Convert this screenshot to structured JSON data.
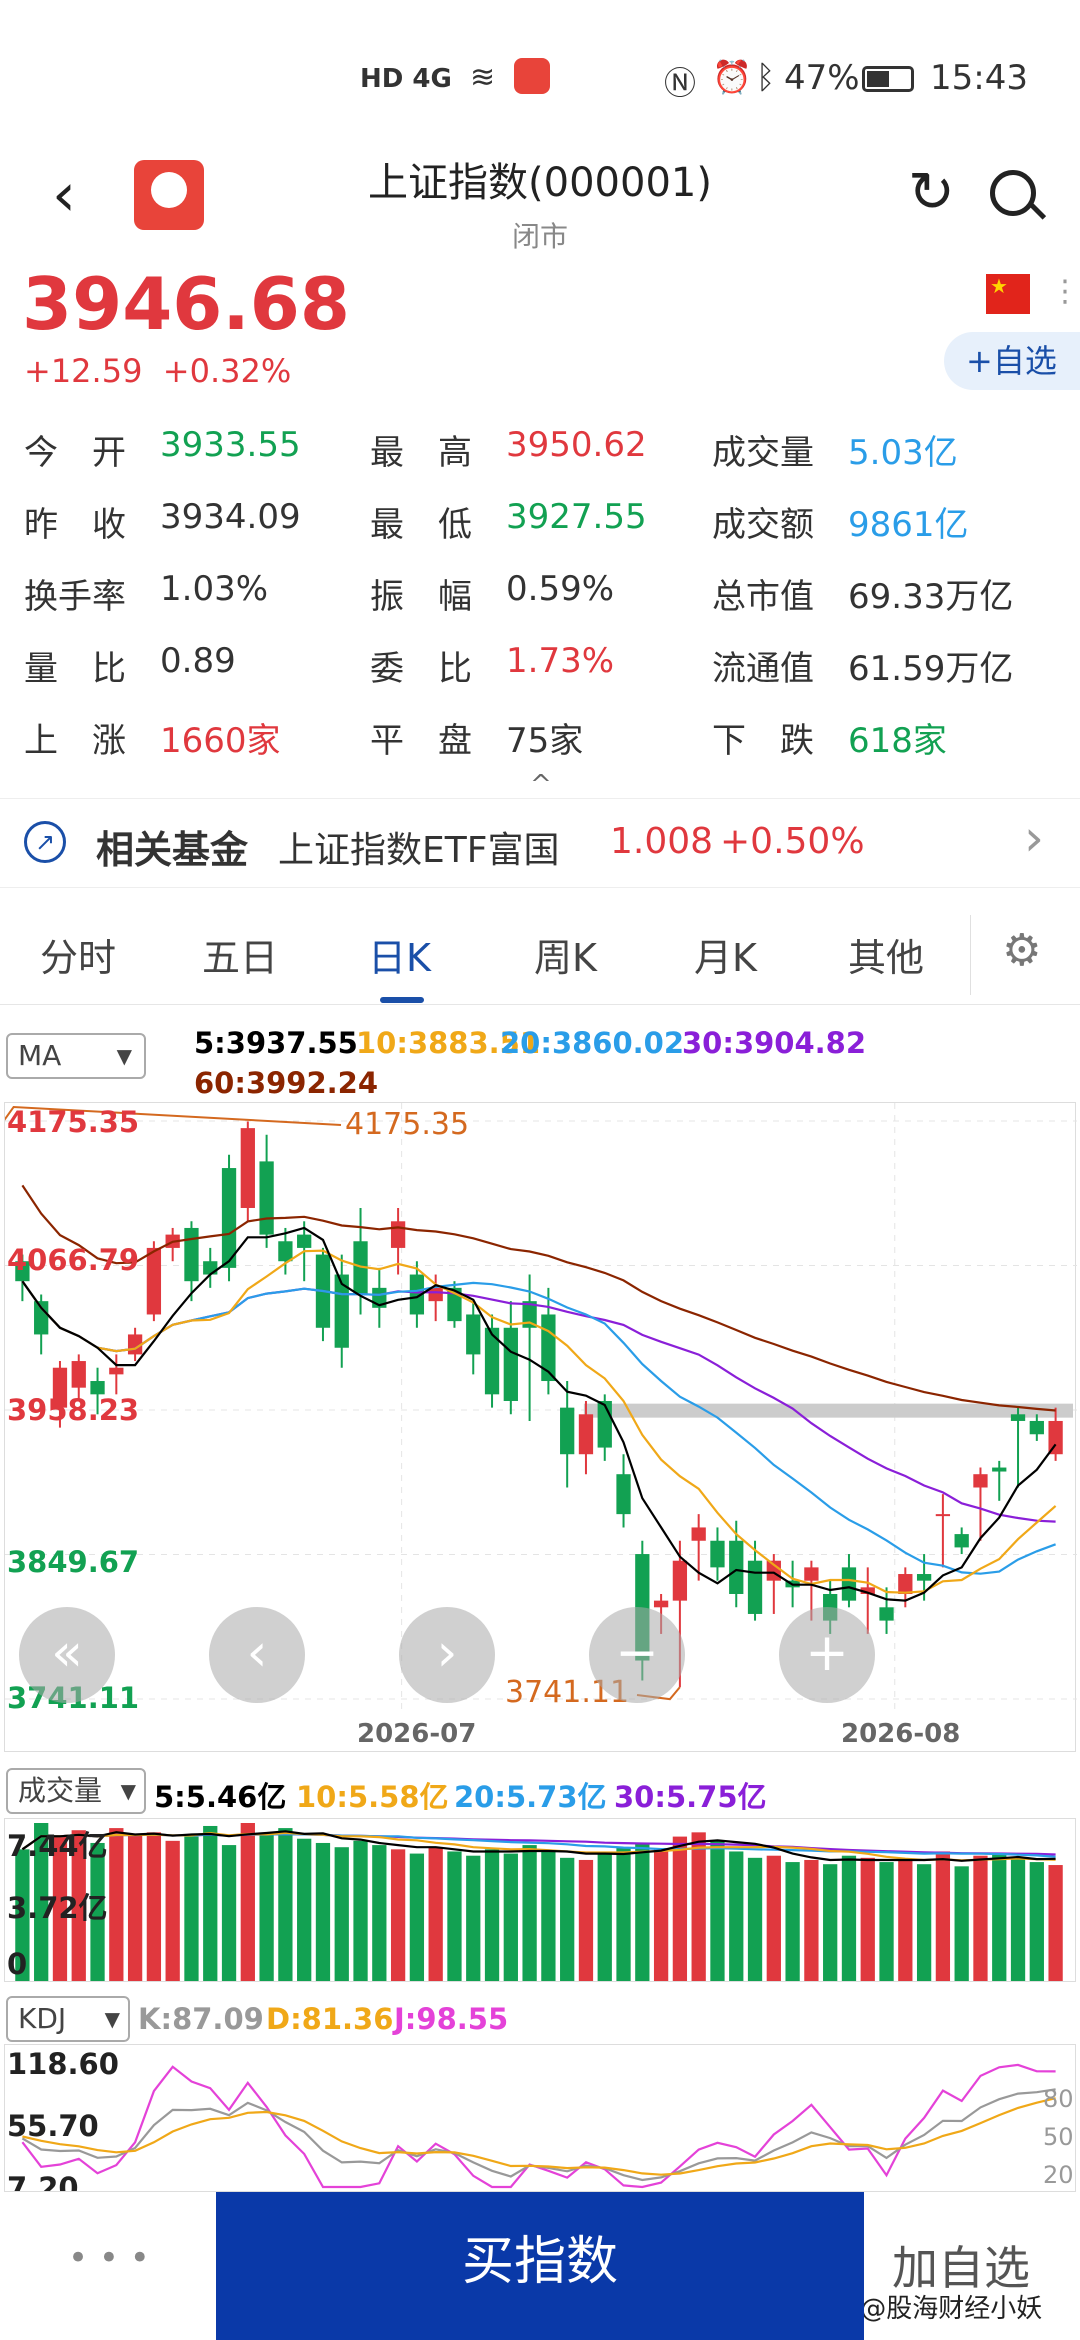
{
  "status_bar": {
    "network": "HD 4G",
    "battery": "47%",
    "time": "15:43"
  },
  "header": {
    "title": "上证指数(000001)",
    "subtitle": "闭市",
    "back_icon": "back-arrow-icon",
    "refresh_icon": "refresh-icon",
    "search_icon": "search-icon",
    "add_watch": "+自选"
  },
  "quote": {
    "price": "3946.68",
    "change": "+12.59",
    "change_pct": "+0.32%"
  },
  "stats": [
    {
      "label": "今　开",
      "value": "3933.55",
      "color": "green"
    },
    {
      "label": "最　高",
      "value": "3950.62",
      "color": "red"
    },
    {
      "label": "成交量",
      "value": "5.03亿",
      "color": "blue"
    },
    {
      "label": "昨　收",
      "value": "3934.09",
      "color": "dark"
    },
    {
      "label": "最　低",
      "value": "3927.55",
      "color": "green"
    },
    {
      "label": "成交额",
      "value": "9861亿",
      "color": "blue"
    },
    {
      "label": "换手率",
      "value": "1.03%",
      "color": "dark"
    },
    {
      "label": "振　幅",
      "value": "0.59%",
      "color": "dark"
    },
    {
      "label": "总市值",
      "value": "69.33万亿",
      "color": "dark"
    },
    {
      "label": "量　比",
      "value": "0.89",
      "color": "dark"
    },
    {
      "label": "委　比",
      "value": "1.73%",
      "color": "red"
    },
    {
      "label": "流通值",
      "value": "61.59万亿",
      "color": "dark"
    },
    {
      "label": "上　涨",
      "value": "1660家",
      "color": "red"
    },
    {
      "label": "平　盘",
      "value": "75家",
      "color": "dark"
    },
    {
      "label": "下　跌",
      "value": "618家",
      "color": "green"
    }
  ],
  "fund": {
    "label": "相关基金",
    "name": "上证指数ETF富国",
    "price": "1.008",
    "change": "+0.50%"
  },
  "tabs": [
    "分时",
    "五日",
    "日K",
    "周K",
    "月K",
    "其他"
  ],
  "active_tab": "日K",
  "ma": {
    "selector": "MA",
    "ma5": "5:3937.55",
    "ma10": "10:3883.51",
    "ma20": "20:3860.02",
    "ma30": "30:3904.82",
    "ma60": "60:3992.24",
    "colors": {
      "ma5": "#000000",
      "ma10": "#f0a818",
      "ma20": "#2a9de8",
      "ma30": "#8a1fd8",
      "ma60": "#8b2500"
    }
  },
  "kline": {
    "y_labels": [
      "4175.35",
      "4066.79",
      "3958.23",
      "3849.67",
      "3741.11"
    ],
    "high_marker": "4175.35",
    "low_marker": "3741.11",
    "x_labels": [
      "2026-07",
      "2026-08"
    ]
  },
  "volume": {
    "selector": "成交量",
    "v5": "5:5.46亿",
    "v10": "10:5.58亿",
    "v20": "20:5.73亿",
    "v30": "30:5.75亿",
    "y_labels": [
      "7.44亿",
      "3.72亿",
      "0"
    ]
  },
  "kdj": {
    "selector": "KDJ",
    "k": "K:87.09",
    "d": "D:81.36",
    "j": "J:98.55",
    "y_labels": [
      "118.60",
      "55.70",
      "7.20"
    ],
    "right_labels": [
      "80",
      "50",
      "20"
    ]
  },
  "bottom": {
    "more": "• • •",
    "buy": "买指数",
    "add_watch": "加自选",
    "watermark": "头条 @股海财经小妖"
  },
  "chart_data": {
    "type": "candlestick",
    "ylim": [
      3741.11,
      4175.35
    ],
    "x_labels": [
      "2026-07",
      "2026-08"
    ],
    "ohlc": [
      [
        4070,
        4075,
        4040,
        4055
      ],
      [
        4040,
        4045,
        4000,
        4015
      ],
      [
        3960,
        3995,
        3945,
        3990
      ],
      [
        3975,
        4000,
        3965,
        3995
      ],
      [
        3980,
        3990,
        3955,
        3970
      ],
      [
        3985,
        4000,
        3970,
        3990
      ],
      [
        4000,
        4020,
        3995,
        4015
      ],
      [
        4030,
        4085,
        4025,
        4080
      ],
      [
        4080,
        4095,
        4070,
        4090
      ],
      [
        4095,
        4100,
        4040,
        4055
      ],
      [
        4070,
        4080,
        4050,
        4060
      ],
      [
        4140,
        4150,
        4055,
        4065
      ],
      [
        4110,
        4175,
        4100,
        4170
      ],
      [
        4145,
        4165,
        4080,
        4090
      ],
      [
        4085,
        4095,
        4060,
        4070
      ],
      [
        4090,
        4100,
        4055,
        4080
      ],
      [
        4075,
        4080,
        4010,
        4020
      ],
      [
        4060,
        4075,
        3990,
        4005
      ],
      [
        4085,
        4110,
        4030,
        4045
      ],
      [
        4050,
        4065,
        4020,
        4035
      ],
      [
        4080,
        4110,
        4060,
        4100
      ],
      [
        4060,
        4070,
        4020,
        4030
      ],
      [
        4040,
        4060,
        4025,
        4050
      ],
      [
        4050,
        4055,
        4020,
        4025
      ],
      [
        4030,
        4040,
        3985,
        4000
      ],
      [
        4020,
        4030,
        3960,
        3970
      ],
      [
        4020,
        4040,
        3955,
        3965
      ],
      [
        4040,
        4060,
        3950,
        4020
      ],
      [
        4030,
        4050,
        3970,
        3980
      ],
      [
        3960,
        3980,
        3900,
        3925
      ],
      [
        3925,
        3965,
        3910,
        3955
      ],
      [
        3965,
        3970,
        3920,
        3930
      ],
      [
        3910,
        3925,
        3870,
        3880
      ],
      [
        3850,
        3860,
        3755,
        3770
      ],
      [
        3810,
        3820,
        3790,
        3815
      ],
      [
        3815,
        3860,
        3750,
        3845
      ],
      [
        3860,
        3880,
        3830,
        3870
      ],
      [
        3860,
        3870,
        3830,
        3840
      ],
      [
        3860,
        3875,
        3810,
        3820
      ],
      [
        3845,
        3860,
        3800,
        3805
      ],
      [
        3830,
        3850,
        3805,
        3845
      ],
      [
        3830,
        3845,
        3810,
        3825
      ],
      [
        3830,
        3845,
        3800,
        3840
      ],
      [
        3820,
        3830,
        3790,
        3800
      ],
      [
        3840,
        3850,
        3810,
        3815
      ],
      [
        3820,
        3840,
        3790,
        3825
      ],
      [
        3810,
        3825,
        3790,
        3800
      ],
      [
        3820,
        3840,
        3810,
        3835
      ],
      [
        3835,
        3850,
        3815,
        3830
      ],
      [
        3880,
        3895,
        3840,
        3880
      ],
      [
        3865,
        3870,
        3850,
        3855
      ],
      [
        3900,
        3915,
        3860,
        3910
      ],
      [
        3915,
        3920,
        3890,
        3912
      ],
      [
        3955,
        3960,
        3900,
        3950
      ],
      [
        3950,
        3955,
        3935,
        3940
      ],
      [
        3925,
        3960,
        3920,
        3950
      ]
    ],
    "volume": [
      6.2,
      7.44,
      6.8,
      7.1,
      6.5,
      7.2,
      6.9,
      7.0,
      6.6,
      6.8,
      7.3,
      6.4,
      7.44,
      6.9,
      7.2,
      6.7,
      6.5,
      6.3,
      6.6,
      6.4,
      6.2,
      6.0,
      6.3,
      6.1,
      5.9,
      6.2,
      6.0,
      6.4,
      6.1,
      5.8,
      5.7,
      6.0,
      6.3,
      6.5,
      6.2,
      6.8,
      7.0,
      6.6,
      6.1,
      5.8,
      5.9,
      5.6,
      5.7,
      5.5,
      5.9,
      5.8,
      5.6,
      5.7,
      5.5,
      6.1,
      5.4,
      5.9,
      6.0,
      5.8,
      5.6,
      5.46
    ],
    "kdj_range": [
      7.2,
      118.6
    ]
  }
}
